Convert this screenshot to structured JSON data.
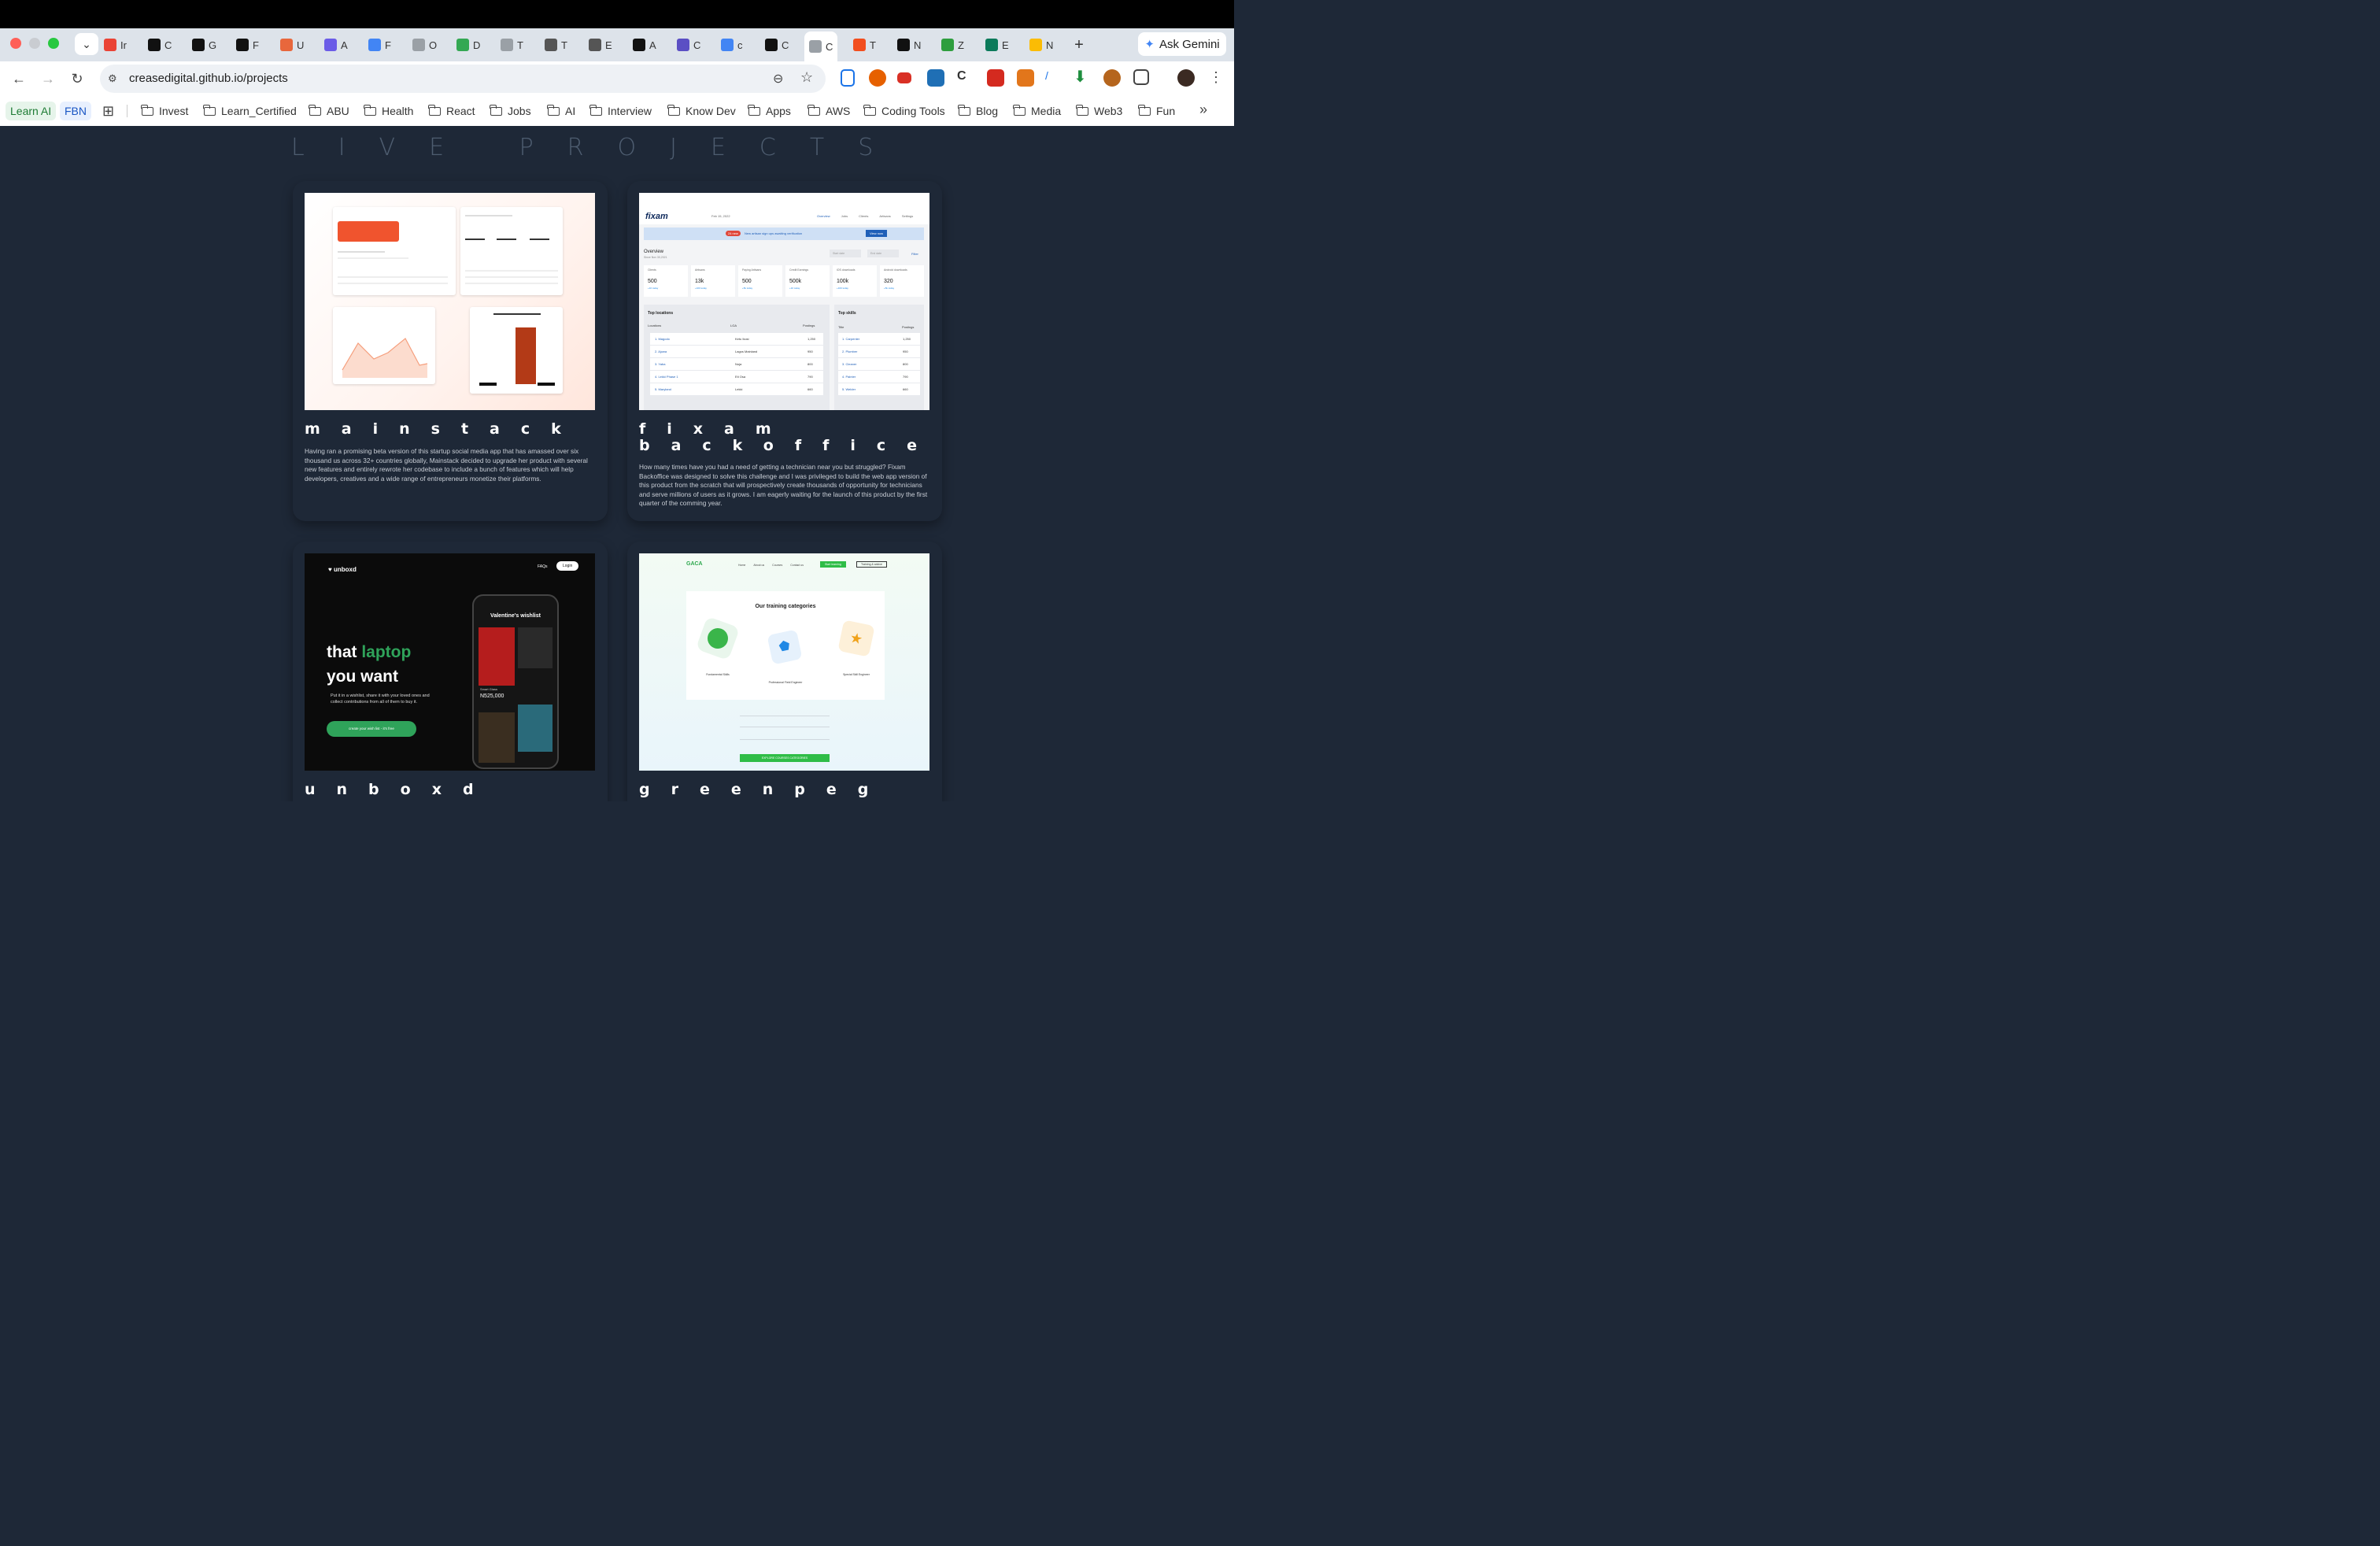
{
  "browser": {
    "tabs": [
      {
        "label": "Ir",
        "icon": "gmail-icon",
        "color": "#ea4335"
      },
      {
        "label": "C",
        "icon": "claude-icon",
        "color": "#111111"
      },
      {
        "label": "G",
        "icon": "anthropic-icon",
        "color": "#111111"
      },
      {
        "label": "F",
        "icon": "framer-icon",
        "color": "#111111"
      },
      {
        "label": "U",
        "icon": "sun-icon",
        "color": "#e8673c"
      },
      {
        "label": "A",
        "icon": "app-icon",
        "color": "#6b5ce7"
      },
      {
        "label": "F",
        "icon": "gemini-icon",
        "color": "#4285f4"
      },
      {
        "label": "O",
        "icon": "globe-icon",
        "color": "#9aa0a6"
      },
      {
        "label": "D",
        "icon": "drive-icon",
        "color": "#34a853"
      },
      {
        "label": "T",
        "icon": "globe-icon",
        "color": "#9aa0a6"
      },
      {
        "label": "T",
        "icon": "hand-icon",
        "color": "#555555"
      },
      {
        "label": "E",
        "icon": "document-icon",
        "color": "#555555"
      },
      {
        "label": "A",
        "icon": "c-circle-icon",
        "color": "#111111"
      },
      {
        "label": "C",
        "icon": "asterisk-icon",
        "color": "#5b4fc4"
      },
      {
        "label": "c",
        "icon": "google-icon",
        "color": "#4285f4"
      },
      {
        "label": "C",
        "icon": "oc-icon",
        "color": "#111111"
      },
      {
        "label": "C",
        "icon": "globe-icon",
        "color": "#9aa0a6"
      },
      {
        "label": "T",
        "icon": "figma-icon",
        "color": "#f24e1e"
      },
      {
        "label": "N",
        "icon": "notion-icon",
        "color": "#111111"
      },
      {
        "label": "Z",
        "icon": "z-icon",
        "color": "#2e9e3e"
      },
      {
        "label": "E",
        "icon": "edit-icon",
        "color": "#0b7a5a"
      },
      {
        "label": "N",
        "icon": "drive-icon",
        "color": "#fbbc04"
      }
    ],
    "active_tab_index": 16,
    "new_tab_label": "+",
    "gemini_label": "Ask Gemini",
    "url": "creasedigital.github.io/projects",
    "bookmark_pills": [
      {
        "label": "Learn AI",
        "bg": "#e6f4ea",
        "color": "#1e7b34"
      },
      {
        "label": "FBN",
        "bg": "#e8f0fe",
        "color": "#1a56c4"
      }
    ],
    "bookmark_folders": [
      "Invest",
      "Learn_Certified",
      "ABU",
      "Health",
      "React",
      "Jobs",
      "AI",
      "Interview",
      "Know Dev",
      "Apps",
      "AWS",
      "Coding Tools",
      "Blog",
      "Media",
      "Web3",
      "Fun"
    ],
    "more_label": "»"
  },
  "page": {
    "section_title": "LIVE PROJECTS",
    "projects": [
      {
        "name": "mainstack",
        "description": "Having ran a promising beta version of this startup social media app that has amassed over six thousand us across 32+ countries globally, Mainstack decided to upgrade her product with several new features and entirely rewrote her codebase to include a bunch of features which will help developers, creatives and a wide range of entrepreneurs monetize their platforms."
      },
      {
        "name": "fixam backoffice",
        "description": "How many times have you had a need of getting a technician near you but struggled? Fixam Backoffice was designed to solve this challenge and I was privileged to build the web app version of this product from the scratch that will prospectively create thousands of opportunity for technicians and serve millions of users as it grows. I am eagerly waiting for the launch of this product by the first quarter of the comming year.",
        "thumb": {
          "brand": "fixam",
          "date": "Feb 15, 2022",
          "nav": [
            "Overview",
            "Jobs",
            "Clients",
            "Artisans",
            "Settings"
          ],
          "banner_badge": "24 new",
          "banner_text": "New artisan sign ups awaiting verification",
          "banner_button": "View now",
          "overview_title": "Overview",
          "overview_sub": "Since Nov 30,2021",
          "start_date": "Start date",
          "end_date": "End date",
          "filter": "Filter",
          "stats": [
            {
              "label": "Clients",
              "value": "500",
              "delta": "+10 today"
            },
            {
              "label": "Artisans",
              "value": "13k",
              "delta": "+100 today"
            },
            {
              "label": "Paying Artisans",
              "value": "500",
              "delta": "+5k today"
            },
            {
              "label": "Credit Earnings",
              "value": "500k",
              "delta": "+10 today"
            },
            {
              "label": "iOS downloads",
              "value": "100k",
              "delta": "+100 today"
            },
            {
              "label": "Android downloads",
              "value": "320",
              "delta": "+5k today"
            }
          ],
          "locations_title": "Top locations",
          "locations_headers": [
            "Locations",
            "LGA",
            "Postings"
          ],
          "locations": [
            [
              "1. Magodo",
              "Ketu Ikosi",
              "1,250"
            ],
            [
              "2. Ajuwa",
              "Lagos Mainland",
              "950"
            ],
            [
              "3. Yaba",
              "Noja",
              "800"
            ],
            [
              "4. Lekki Phase 1",
              "Eti Osa",
              "790"
            ],
            [
              "5. Maryland",
              "Lekki",
              "660"
            ]
          ],
          "skills_title": "Top skills",
          "skills_headers": [
            "Title",
            "Postings"
          ],
          "skills": [
            [
              "1. Carpenter",
              "1,250"
            ],
            [
              "2. Plumber",
              "950"
            ],
            [
              "3. Cleaner",
              "800"
            ],
            [
              "4. Painter",
              "790"
            ],
            [
              "5. Welder",
              "660"
            ]
          ]
        }
      },
      {
        "name": "unboxd",
        "description": "",
        "thumb": {
          "brand": "unboxd",
          "faqs": "FAQs",
          "login": "Login",
          "headline_1": "that",
          "headline_accent": "laptop",
          "headline_2": "you want",
          "body": "Put it in a wishlist, share it with your loved ones and collect contributions from all of them to buy it.",
          "cta": "create your wish list - it's free",
          "phone_title": "Valentine's wishlist",
          "phone_price": "N525,000",
          "phone_item": "Smart Glass",
          "accent": "#2fa35a"
        }
      },
      {
        "name": "greenpeg",
        "description": "",
        "thumb": {
          "brand": "GACA",
          "nav": [
            "Home",
            "About us",
            "Courses",
            "Contact us"
          ],
          "btn_primary": "Start learning",
          "btn_secondary": "Training & advice",
          "heading": "Our training categories",
          "categories": [
            "Fundamental Skills",
            "Professional Field Engineer",
            "Special Skill Engineer"
          ],
          "explore": "EXPLORE COURSES CATEGORIES"
        }
      }
    ]
  }
}
